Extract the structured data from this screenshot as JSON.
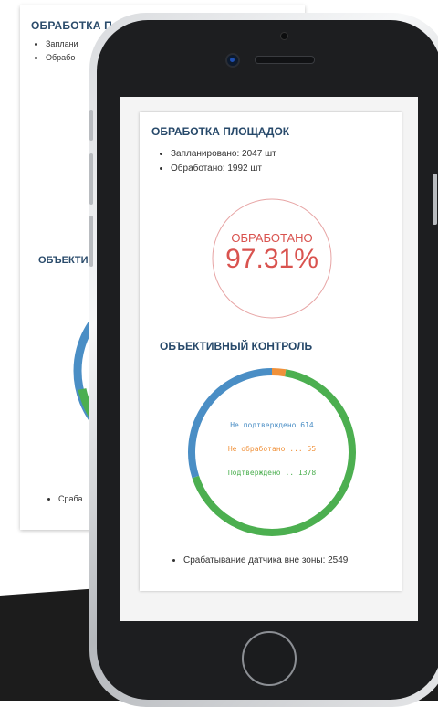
{
  "processing": {
    "title": "ОБРАБОТКА ПЛОЩАДОК",
    "items": [
      "Запланировано: 2047 шт",
      "Обработано: 1992 шт"
    ],
    "done_label": "ОБРАБОТАНО",
    "done_value": "97.31%",
    "color": "#d9534f"
  },
  "control": {
    "title": "ОБЪЕКТИВНЫЙ КОНТРОЛЬ",
    "legend": [
      {
        "label": "Не подтверждено 614",
        "color": "#4a8ec5"
      },
      {
        "label": "Не обработано ... 55",
        "color": "#f0913a"
      },
      {
        "label": "Подтверждено .. 1378",
        "color": "#4caf50"
      }
    ],
    "sensor_text": "Срабатывание датчика вне зоны: 2549"
  },
  "background_sheet": {
    "title": "ОБРАБОТКА П",
    "items": [
      "Заплани",
      "Обрабо"
    ],
    "title2": "ОБЪЕКТИ",
    "bullet": "Сраба"
  },
  "chart_data": {
    "type": "pie",
    "categories": [
      "Не подтверждено",
      "Не обработано",
      "Подтверждено"
    ],
    "values": [
      614,
      55,
      1378
    ],
    "colors": [
      "#4a8ec5",
      "#f0913a",
      "#4caf50"
    ]
  }
}
